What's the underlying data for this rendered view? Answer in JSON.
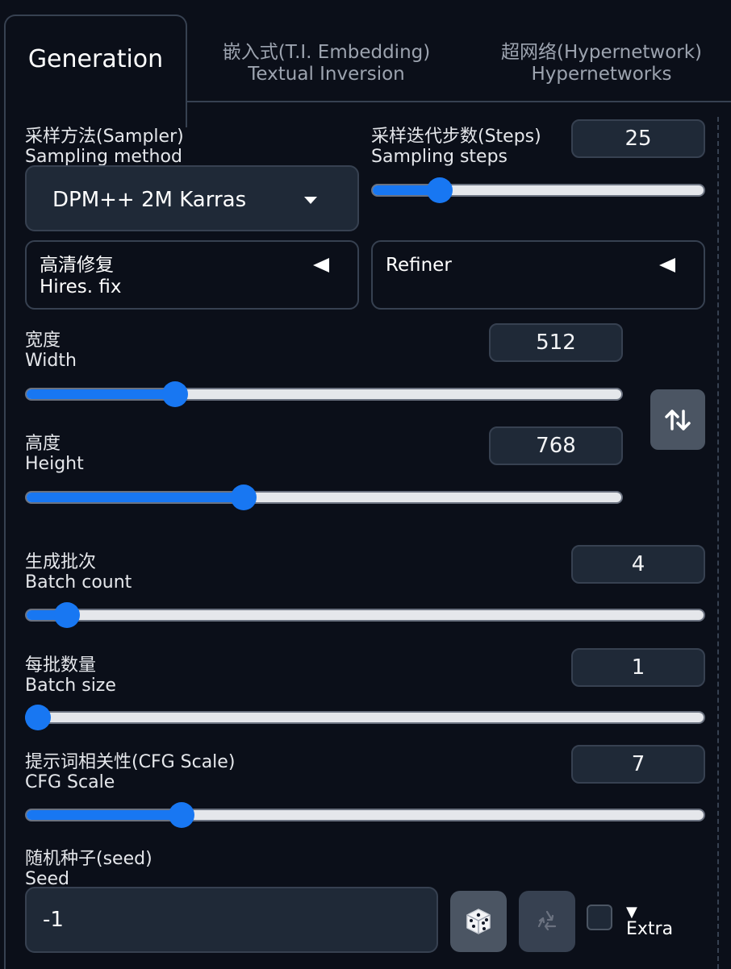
{
  "tabs": [
    {
      "label": "Generation",
      "active": true
    },
    {
      "label_zh": "嵌入式(T.I. Embedding)",
      "label_en": "Textual Inversion"
    },
    {
      "label_zh": "超网络(Hypernetwork)",
      "label_en": "Hypernetworks"
    }
  ],
  "sampler": {
    "label_zh": "采样方法(Sampler)",
    "label_en": "Sampling method",
    "value": "DPM++ 2M Karras"
  },
  "steps": {
    "label_zh": "采样迭代步数(Steps)",
    "label_en": "Sampling steps",
    "value": "25",
    "fraction": 0.18
  },
  "hires": {
    "label_zh": "高清修复",
    "label_en": "Hires. fix"
  },
  "refiner": {
    "label": "Refiner"
  },
  "width": {
    "label_zh": "宽度",
    "label_en": "Width",
    "value": "512",
    "fraction": 0.24
  },
  "height": {
    "label_zh": "高度",
    "label_en": "Height",
    "value": "768",
    "fraction": 0.36
  },
  "batch_count": {
    "label_zh": "生成批次",
    "label_en": "Batch count",
    "value": "4",
    "fraction": 0.045
  },
  "batch_size": {
    "label_zh": "每批数量",
    "label_en": "Batch size",
    "value": "1",
    "fraction": 0.0
  },
  "cfg": {
    "label_zh": "提示词相关性(CFG Scale)",
    "label_en": "CFG Scale",
    "value": "7",
    "fraction": 0.22
  },
  "seed": {
    "label_zh": "随机种子(seed)",
    "label_en": "Seed",
    "value": "-1"
  },
  "extra": {
    "label": "Extra",
    "triangle": "▼"
  },
  "icons": {
    "dropdown": "chevron-down-icon",
    "accordion": "triangle-left-icon",
    "swap": "swap-arrows-icon",
    "dice": "dice-icon",
    "recycle": "recycle-icon"
  },
  "colors": {
    "accent": "#1877f2",
    "background": "#0b0f19",
    "field": "#1f2937",
    "border": "#374151"
  }
}
